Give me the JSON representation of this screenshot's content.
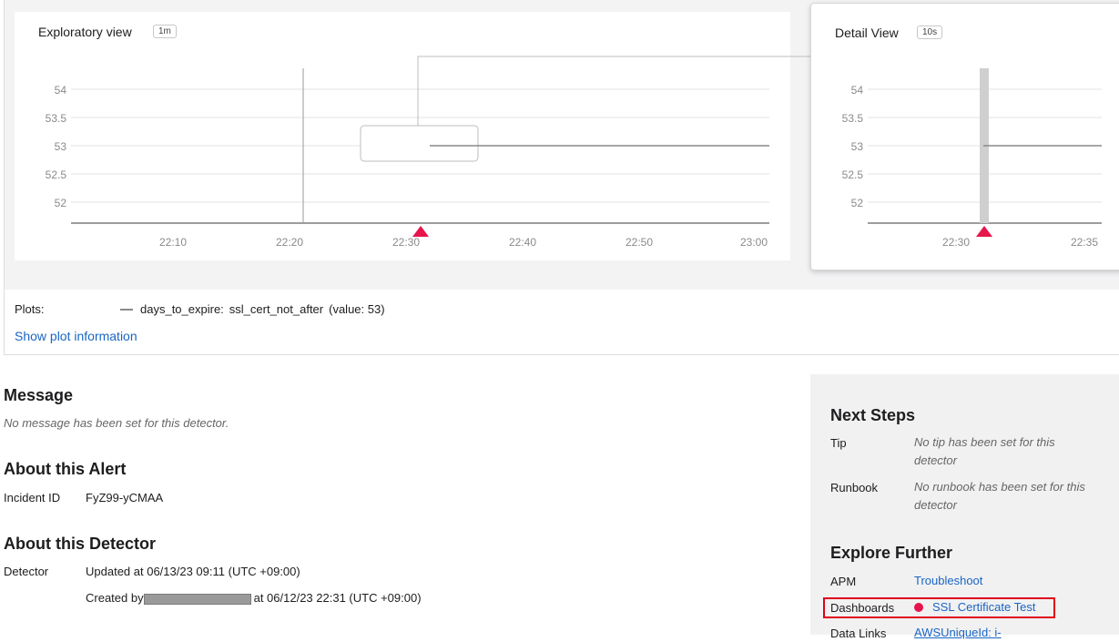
{
  "explore": {
    "title": "Exploratory view",
    "resolution": "1m",
    "y_ticks": [
      "54",
      "53.5",
      "53",
      "52.5",
      "52"
    ],
    "x_ticks": [
      "22:10",
      "22:20",
      "22:30",
      "22:40",
      "22:50",
      "23:00"
    ]
  },
  "detail": {
    "title": "Detail View",
    "resolution": "10s",
    "y_ticks": [
      "54",
      "53.5",
      "53",
      "52.5",
      "52"
    ],
    "x_ticks": [
      "22:30",
      "22:35"
    ]
  },
  "chart_data": [
    {
      "type": "line",
      "title": "Exploratory view",
      "x": [
        "22:30",
        "22:40",
        "22:50",
        "23:00"
      ],
      "series": [
        {
          "name": "days_to_expire: ssl_cert_not_after",
          "values": [
            53,
            53,
            53,
            53
          ]
        }
      ],
      "ylim": [
        52,
        54
      ]
    },
    {
      "type": "line",
      "title": "Detail View",
      "x": [
        "22:30",
        "22:35"
      ],
      "series": [
        {
          "name": "days_to_expire: ssl_cert_not_after",
          "values": [
            53,
            53
          ]
        }
      ],
      "ylim": [
        52,
        54
      ]
    }
  ],
  "plots": {
    "label": "Plots:",
    "metric": "days_to_expire:",
    "signal": "ssl_cert_not_after",
    "value_text": "(value: 53)",
    "show_info": "Show plot information"
  },
  "message": {
    "heading": "Message",
    "text": "No message has been set for this detector."
  },
  "alert": {
    "heading": "About this Alert",
    "incident_label": "Incident ID",
    "incident_id": "FyZ99-yCMAA"
  },
  "detector": {
    "heading": "About this Detector",
    "label": "Detector",
    "updated": "Updated at 06/13/23 09:11 (UTC +09:00)",
    "created_prefix": "Created by",
    "created_suffix": "at 06/12/23 22:31 (UTC +09:00)"
  },
  "next_steps": {
    "heading": "Next Steps",
    "tip_label": "Tip",
    "tip_text": "No tip has been set for this detector",
    "runbook_label": "Runbook",
    "runbook_text": "No runbook has been set for this detector"
  },
  "explore_further": {
    "heading": "Explore Further",
    "apm_label": "APM",
    "apm_link": "Troubleshoot",
    "dashboards_label": "Dashboards",
    "dashboards_link": "SSL Certificate Test",
    "datalinks_label": "Data Links",
    "datalinks_link": "AWSUniqueId: i-"
  },
  "colors": {
    "alert_marker": "#e6154b",
    "link": "#1a65c4",
    "highlight": "#e0001b"
  }
}
